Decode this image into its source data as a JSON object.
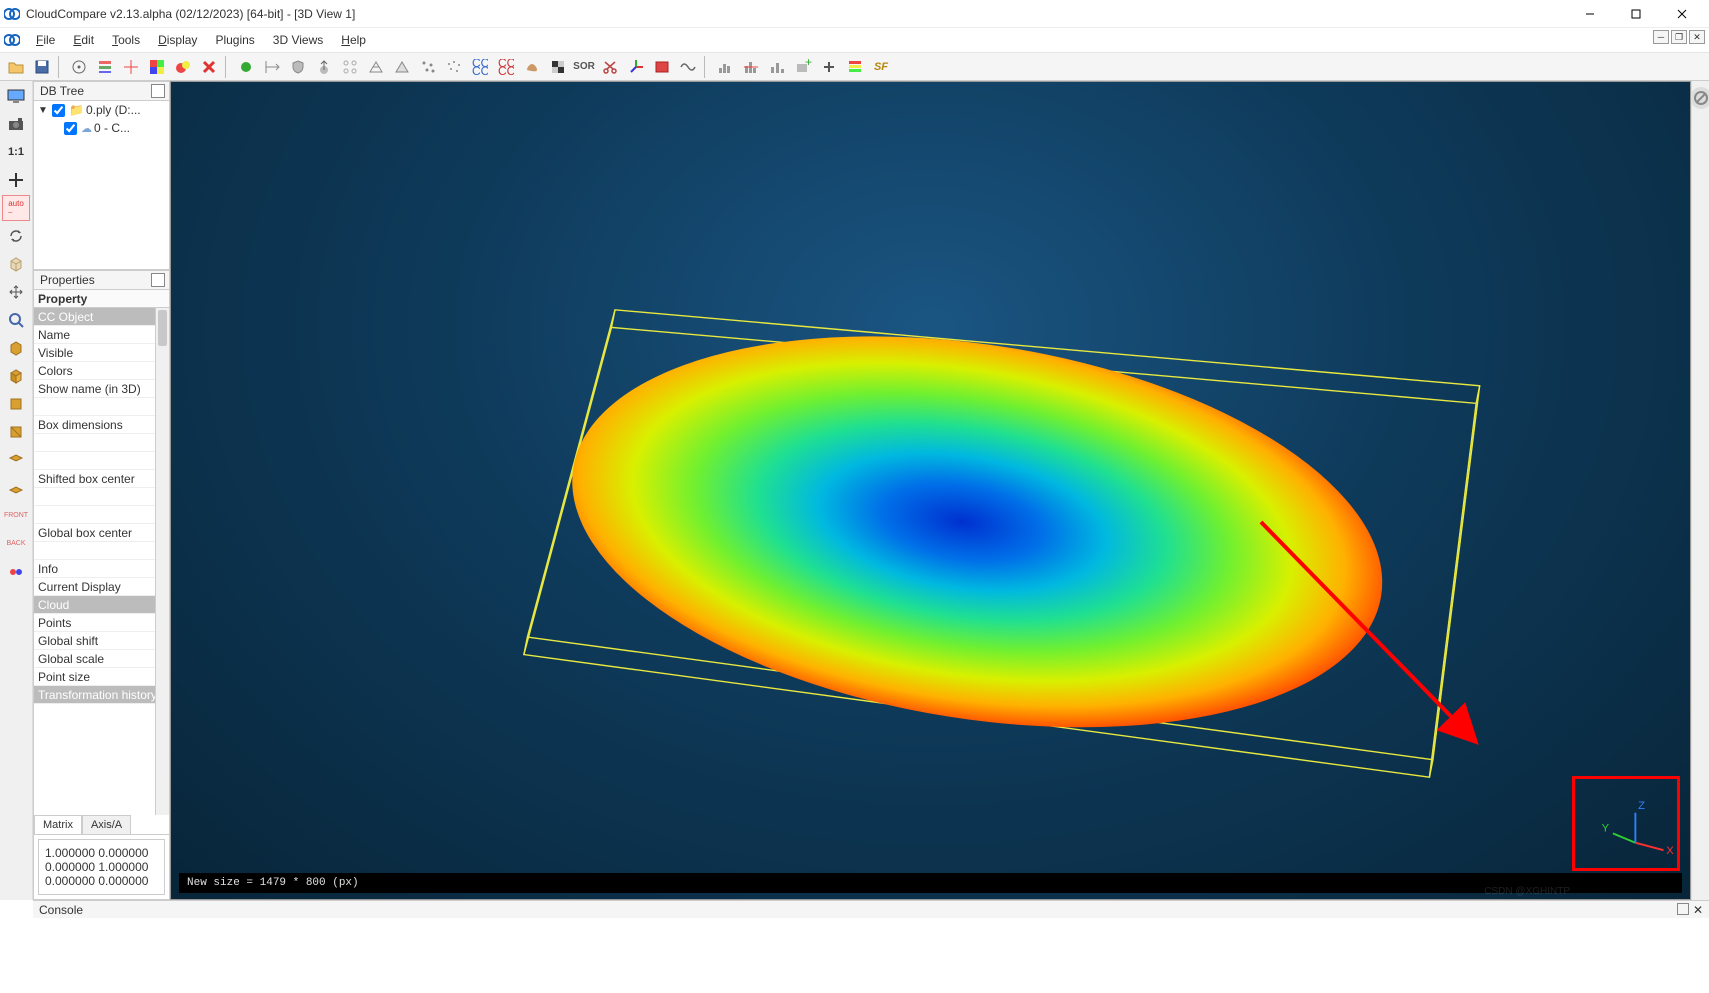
{
  "title": "CloudCompare v2.13.alpha (02/12/2023) [64-bit] - [3D View 1]",
  "menubar": [
    "File",
    "Edit",
    "Tools",
    "Display",
    "Plugins",
    "3D Views",
    "Help"
  ],
  "panels": {
    "dbtree": {
      "title": "DB Tree",
      "root": "0.ply (D:...",
      "child": "0 - C..."
    },
    "properties": {
      "title": "Properties",
      "header": "Property",
      "rows": [
        {
          "t": "section",
          "label": "CC Object"
        },
        {
          "t": "row",
          "label": "Name"
        },
        {
          "t": "row",
          "label": "Visible"
        },
        {
          "t": "row",
          "label": "Colors"
        },
        {
          "t": "row",
          "label": "Show name (in 3D)"
        },
        {
          "t": "row",
          "label": ""
        },
        {
          "t": "row",
          "label": "Box dimensions"
        },
        {
          "t": "row",
          "label": ""
        },
        {
          "t": "row",
          "label": ""
        },
        {
          "t": "row",
          "label": "Shifted box center"
        },
        {
          "t": "row",
          "label": ""
        },
        {
          "t": "row",
          "label": ""
        },
        {
          "t": "row",
          "label": "Global box center"
        },
        {
          "t": "row",
          "label": ""
        },
        {
          "t": "row",
          "label": "Info"
        },
        {
          "t": "row",
          "label": "Current Display"
        },
        {
          "t": "section",
          "label": "Cloud"
        },
        {
          "t": "row",
          "label": "Points"
        },
        {
          "t": "row",
          "label": "Global shift"
        },
        {
          "t": "row",
          "label": "Global scale"
        },
        {
          "t": "row",
          "label": "Point size"
        },
        {
          "t": "section",
          "label": "Transformation history"
        }
      ],
      "tabs": [
        "Matrix",
        "Axis/A"
      ],
      "matrix": [
        "1.000000 0.000000",
        "0.000000 1.000000",
        "0.000000 0.000000"
      ]
    },
    "console": {
      "title": "Console"
    }
  },
  "viewport": {
    "status": "New size = 1479 * 800 (px)",
    "triad": {
      "x": "X",
      "y": "Y",
      "z": "Z"
    },
    "watermark": "CSDN @XGHINTP"
  },
  "tool_icons": [
    "open-icon",
    "save-icon",
    "pick-icon",
    "list-icon",
    "center-icon",
    "color-icon",
    "colorize-icon",
    "delete-icon",
    "sep",
    "point-green-icon",
    "dim-icon",
    "shield-icon",
    "normals-icon",
    "grid-icon",
    "mesh-icon",
    "triangulate-icon",
    "points1-icon",
    "points2-icon",
    "cc-blue-icon",
    "cc-red-icon",
    "rock-icon",
    "checker-icon",
    "sor-icon",
    "scissors-icon",
    "axis-icon",
    "book-icon",
    "wave-icon",
    "sep",
    "hist1-icon",
    "hist2-icon",
    "merge-icon",
    "add-layer-icon",
    "plus-icon",
    "colorbar-icon",
    "sf-icon"
  ],
  "view_icons": [
    "monitor-icon",
    "camera-icon",
    "scale-1to1-icon",
    "crosshair-plus-icon",
    "auto-icon",
    "refresh-icon",
    "cube1-icon",
    "translate-icon",
    "zoom-icon",
    "iso-icon",
    "iso2-icon",
    "top-icon",
    "left-icon",
    "iso3-icon",
    "iso4-icon",
    "front-icon",
    "back-icon",
    "stereo-icon"
  ]
}
